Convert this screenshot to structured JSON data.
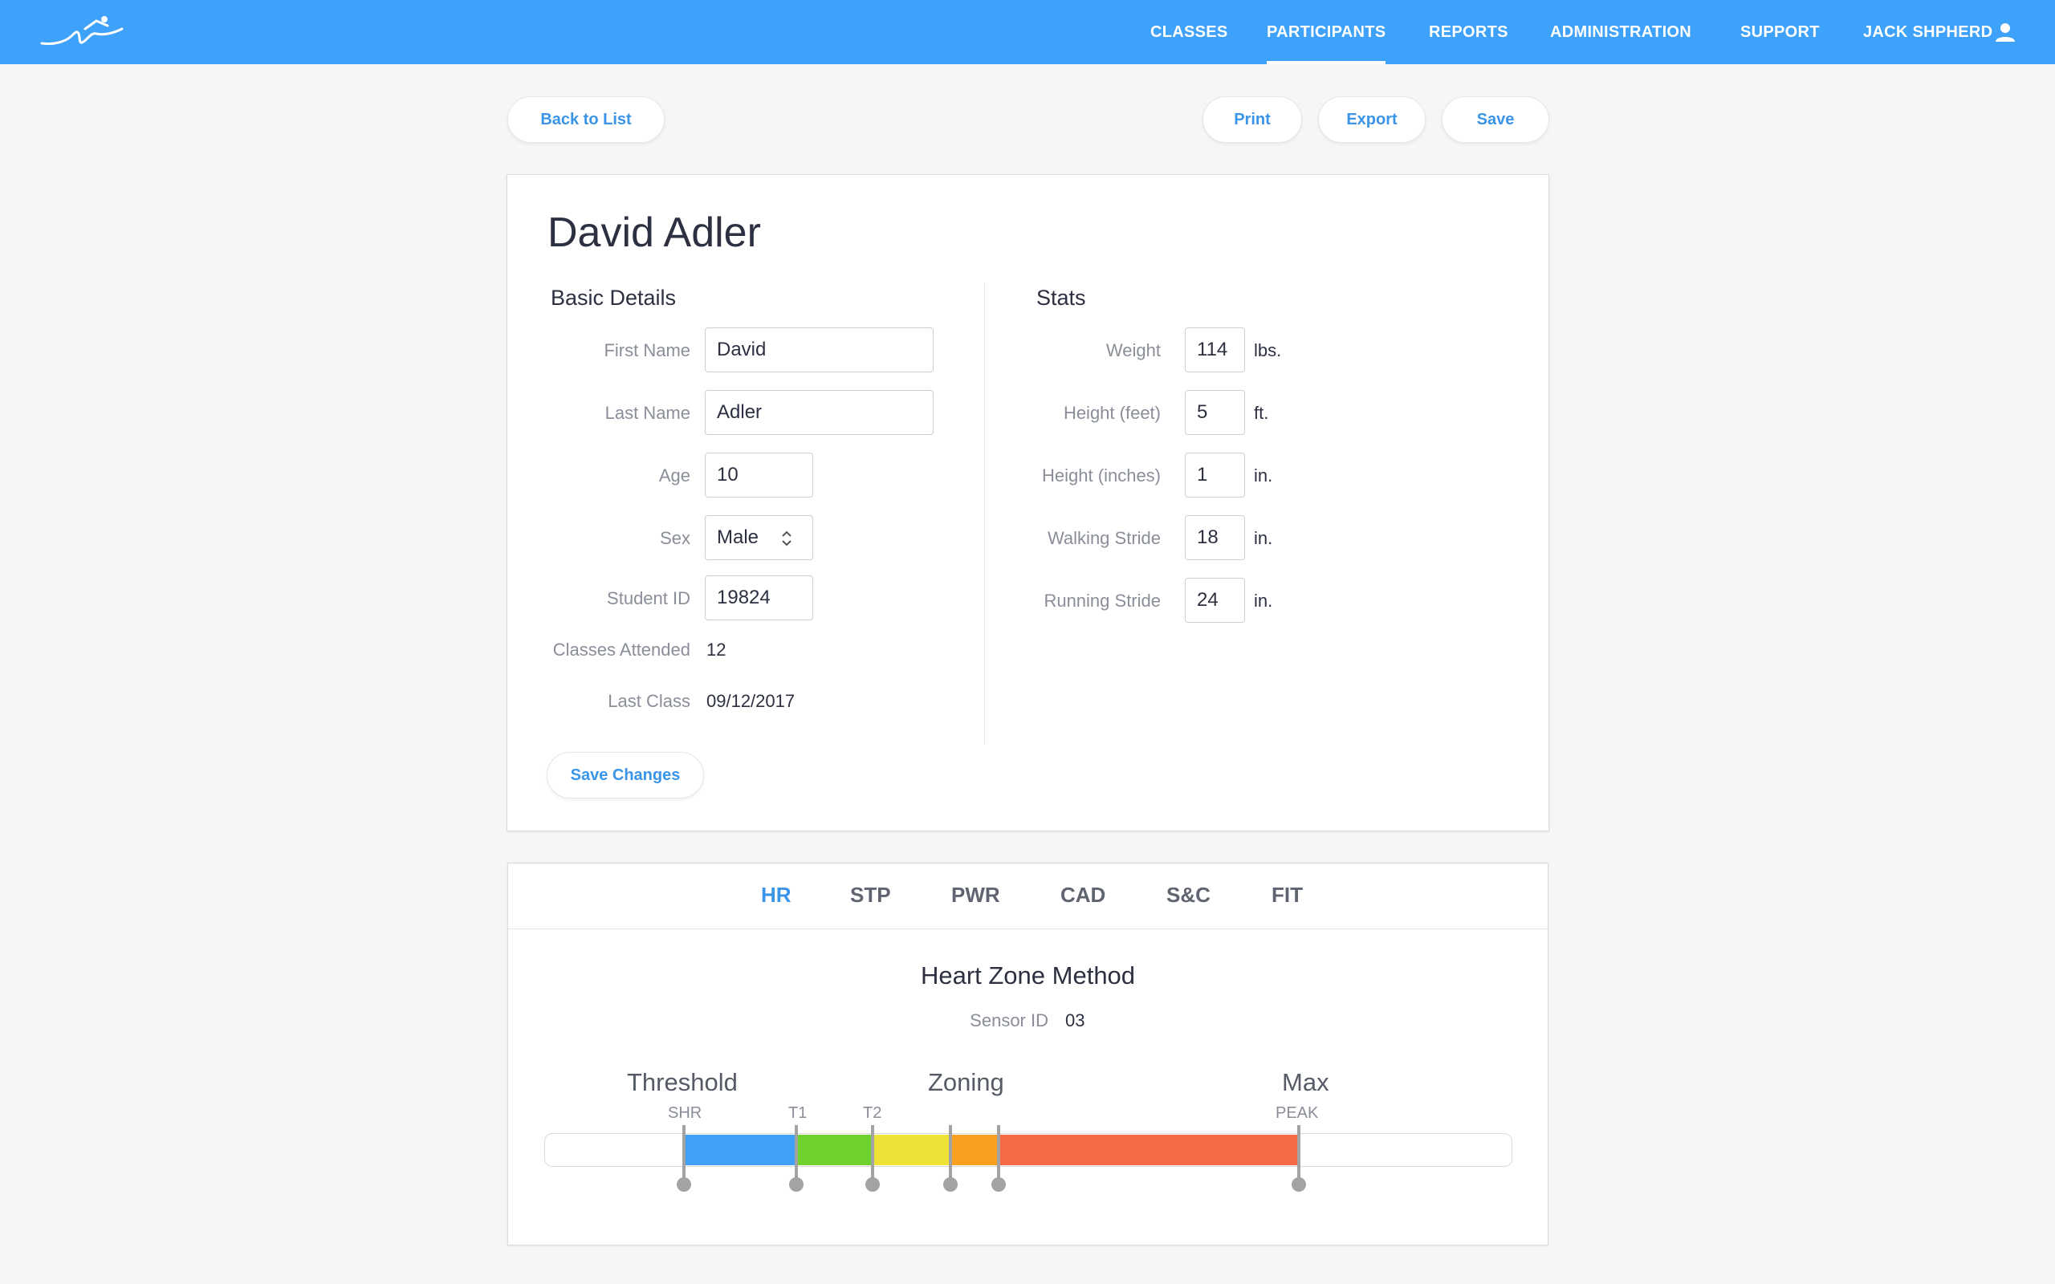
{
  "nav": {
    "items": [
      {
        "label": "CLASSES",
        "active": false
      },
      {
        "label": "PARTICIPANTS",
        "active": true
      },
      {
        "label": "REPORTS",
        "active": false
      },
      {
        "label": "ADMINISTRATION",
        "active": false
      },
      {
        "label": "SUPPORT",
        "active": false
      }
    ],
    "user_name": "JACK SHPHERD",
    "icons": {
      "logo": "runner-logo",
      "user": "user-icon"
    }
  },
  "toolbar": {
    "back_label": "Back to List",
    "print_label": "Print",
    "export_label": "Export",
    "save_label": "Save"
  },
  "participant": {
    "name": "David Adler",
    "basic_details": {
      "title": "Basic Details",
      "first_name_label": "First Name",
      "first_name": "David",
      "last_name_label": "Last Name",
      "last_name": "Adler",
      "age_label": "Age",
      "age": "10",
      "sex_label": "Sex",
      "sex": "Male",
      "student_id_label": "Student ID",
      "student_id": "19824",
      "classes_attended_label": "Classes Attended",
      "classes_attended": "12",
      "last_class_label": "Last Class",
      "last_class": "09/12/2017"
    },
    "stats": {
      "title": "Stats",
      "weight_label": "Weight",
      "weight": "114",
      "weight_unit": "lbs.",
      "height_feet_label": "Height (feet)",
      "height_feet": "5",
      "height_feet_unit": "ft.",
      "height_inches_label": "Height (inches)",
      "height_inches": "1",
      "height_inches_unit": "in.",
      "walking_stride_label": "Walking Stride",
      "walking_stride": "18",
      "walking_stride_unit": "in.",
      "running_stride_label": "Running Stride",
      "running_stride": "24",
      "running_stride_unit": "in."
    },
    "save_changes_label": "Save Changes"
  },
  "tabs": [
    {
      "label": "HR",
      "active": true
    },
    {
      "label": "STP",
      "active": false
    },
    {
      "label": "PWR",
      "active": false
    },
    {
      "label": "CAD",
      "active": false
    },
    {
      "label": "S&C",
      "active": false
    },
    {
      "label": "FIT",
      "active": false
    }
  ],
  "heart_zone": {
    "title": "Heart Zone Method",
    "sensor_id_label": "Sensor ID",
    "sensor_id": "03",
    "threshold_label": "Threshold",
    "zoning_label": "Zoning",
    "max_label": "Max",
    "markers": {
      "shr": "SHR",
      "t1": "T1",
      "t2": "T2",
      "peak": "PEAK"
    },
    "zone_colors": [
      "#3fa0f8",
      "#6fd22c",
      "#eee236",
      "#f9a021",
      "#f66a45"
    ]
  }
}
